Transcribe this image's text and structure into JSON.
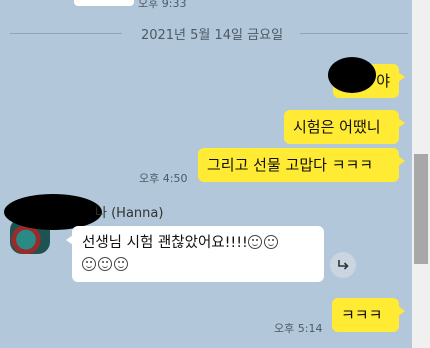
{
  "top": {
    "time": "오후 9:33"
  },
  "divider": {
    "date": "2021년 5월 14일 금요일"
  },
  "messages_me": {
    "m1": "야",
    "m2": "시험은 어땠니",
    "m3": "그리고 선물 고맙다 ㅋㅋㅋ",
    "m3_time": "오후 4:50",
    "m4": "ㅋㅋㅋ",
    "m4_time": "오후 5:14"
  },
  "other": {
    "sender": "나 (Hanna)",
    "text": "선생님 시험 괜찮았어요!!!!"
  },
  "icons": {
    "share": "share-icon",
    "emoji": "smiley-emoji-icon"
  }
}
